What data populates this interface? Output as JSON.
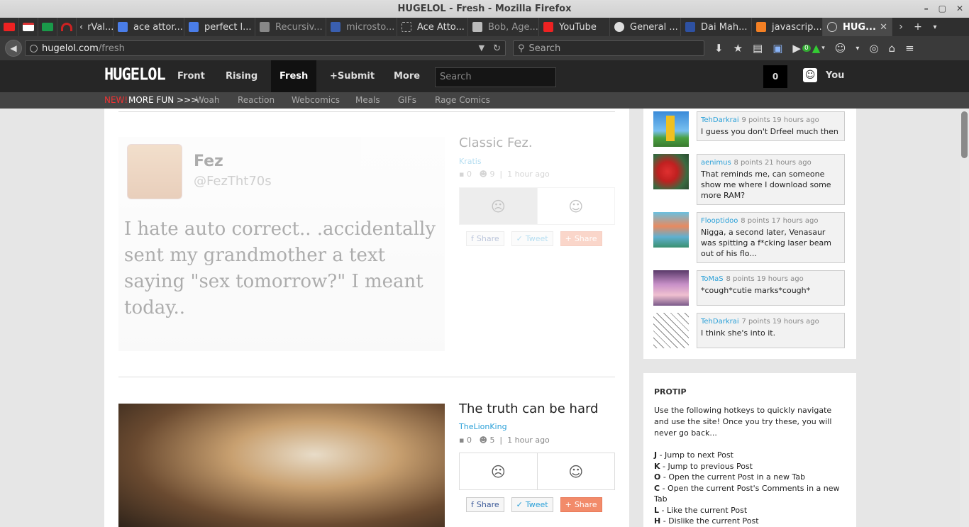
{
  "window": {
    "title": "HUGELOL - Fresh - Mozilla Firefox",
    "controls": [
      "–",
      "▢",
      "✕"
    ]
  },
  "tabs": [
    {
      "label": "rVal...",
      "icon": "back-arrow-icon"
    },
    {
      "label": "ace attor...",
      "icon": "google-icon"
    },
    {
      "label": "perfect l...",
      "icon": "google-icon"
    },
    {
      "label": "Recursiv...",
      "icon": "reddit-icon"
    },
    {
      "label": "microsto...",
      "icon": "google-icon"
    },
    {
      "label": "Ace Atto...",
      "icon": "page-icon"
    },
    {
      "label": "Bob, Age...",
      "icon": "wikipedia-icon"
    },
    {
      "label": "YouTube",
      "icon": "youtube-icon"
    },
    {
      "label": "General ...",
      "icon": "steam-icon"
    },
    {
      "label": "Dai Mah...",
      "icon": "mal-icon"
    },
    {
      "label": "javascrip...",
      "icon": "stackoverflow-icon"
    },
    {
      "label": "HUG...",
      "icon": "hugelol-icon",
      "active": true
    }
  ],
  "navbar": {
    "url_host": "hugelol.com",
    "url_path": "/fresh",
    "search_placeholder": "Search",
    "badge": "0"
  },
  "site": {
    "logo": "HUGELOL",
    "nav": [
      "Front",
      "Rising",
      "Fresh",
      "+Submit",
      "More"
    ],
    "search_placeholder": "Search",
    "notifications": "0",
    "user": "You"
  },
  "subnav": {
    "new": "NEW!",
    "more_fun": "MORE FUN >>>",
    "links": [
      "Woah",
      "Reaction",
      "Webcomics",
      "Meals",
      "GIFs",
      "Rage Comics"
    ]
  },
  "posts": [
    {
      "title": "Classic Fez.",
      "author": "Kratis",
      "comments": "0",
      "points": "9",
      "time": "1 hour ago",
      "tweet": {
        "name": "Fez",
        "handle": "@FezTht70s",
        "text": "I hate auto correct.. .accidentally sent my grandmother a text saying \"sex tomorrow?\" I meant today.."
      }
    },
    {
      "title": "The truth can be hard",
      "author": "TheLionKing",
      "comments": "0",
      "points": "5",
      "time": "1 hour ago"
    }
  ],
  "share": {
    "facebook": "Share",
    "twitter": "Tweet",
    "gplus": "Share"
  },
  "comments": [
    {
      "user": "TehDarkrai",
      "meta": "9 points 19 hours ago",
      "text": "I guess you don't Drfeel much then"
    },
    {
      "user": "aenimus",
      "meta": "8 points 21 hours ago",
      "text": "That reminds me, can someone show me where I download some more RAM?"
    },
    {
      "user": "Flooptidoo",
      "meta": "8 points 17 hours ago",
      "text": "Nigga, a second later, Venasaur was spitting a f*cking laser beam out of his flo..."
    },
    {
      "user": "ToMaS",
      "meta": "8 points 19 hours ago",
      "text": "*cough*cutie marks*cough*"
    },
    {
      "user": "TehDarkrai",
      "meta": "7 points 19 hours ago",
      "text": "I think she's into it."
    }
  ],
  "protip": {
    "title": "PROTIP",
    "intro": "Use the following hotkeys to quickly navigate and use the site! Once you try these, you will never go back...",
    "keys": [
      {
        "key": "J",
        "desc": "- Jump to next Post"
      },
      {
        "key": "K",
        "desc": "- Jump to previous Post"
      },
      {
        "key": "O",
        "desc": "- Open the current Post in a new Tab"
      },
      {
        "key": "C",
        "desc": "- Open the current Post's Comments in a new Tab"
      },
      {
        "key": "L",
        "desc": "- Like the current Post"
      },
      {
        "key": "H",
        "desc": "- Dislike the current Post"
      }
    ]
  }
}
